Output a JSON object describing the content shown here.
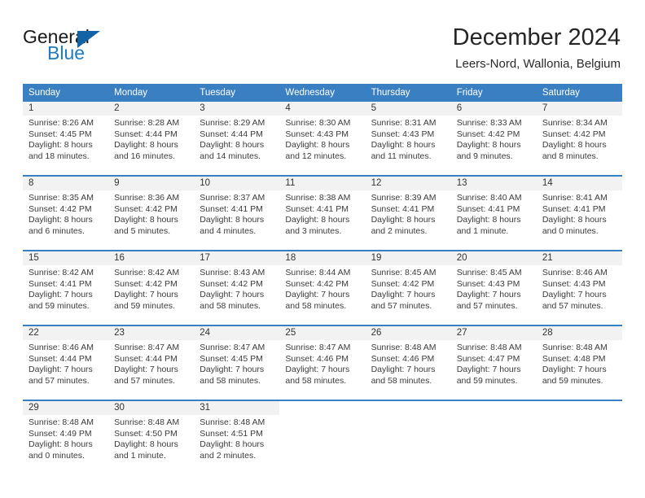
{
  "brand": {
    "word_one": "General",
    "word_two": "Blue",
    "accent_color": "#1464a5",
    "blue_text_color": "#1f7bc1"
  },
  "header": {
    "title": "December 2024",
    "subtitle": "Leers-Nord, Wallonia, Belgium"
  },
  "calendar": {
    "header_bg": "#3a7fc1",
    "daynum_bg": "#f2f2f2",
    "day_names": [
      "Sunday",
      "Monday",
      "Tuesday",
      "Wednesday",
      "Thursday",
      "Friday",
      "Saturday"
    ],
    "weeks": [
      [
        {
          "day": "1",
          "lines": [
            "Sunrise: 8:26 AM",
            "Sunset: 4:45 PM",
            "Daylight: 8 hours",
            "and 18 minutes."
          ]
        },
        {
          "day": "2",
          "lines": [
            "Sunrise: 8:28 AM",
            "Sunset: 4:44 PM",
            "Daylight: 8 hours",
            "and 16 minutes."
          ]
        },
        {
          "day": "3",
          "lines": [
            "Sunrise: 8:29 AM",
            "Sunset: 4:44 PM",
            "Daylight: 8 hours",
            "and 14 minutes."
          ]
        },
        {
          "day": "4",
          "lines": [
            "Sunrise: 8:30 AM",
            "Sunset: 4:43 PM",
            "Daylight: 8 hours",
            "and 12 minutes."
          ]
        },
        {
          "day": "5",
          "lines": [
            "Sunrise: 8:31 AM",
            "Sunset: 4:43 PM",
            "Daylight: 8 hours",
            "and 11 minutes."
          ]
        },
        {
          "day": "6",
          "lines": [
            "Sunrise: 8:33 AM",
            "Sunset: 4:42 PM",
            "Daylight: 8 hours",
            "and 9 minutes."
          ]
        },
        {
          "day": "7",
          "lines": [
            "Sunrise: 8:34 AM",
            "Sunset: 4:42 PM",
            "Daylight: 8 hours",
            "and 8 minutes."
          ]
        }
      ],
      [
        {
          "day": "8",
          "lines": [
            "Sunrise: 8:35 AM",
            "Sunset: 4:42 PM",
            "Daylight: 8 hours",
            "and 6 minutes."
          ]
        },
        {
          "day": "9",
          "lines": [
            "Sunrise: 8:36 AM",
            "Sunset: 4:42 PM",
            "Daylight: 8 hours",
            "and 5 minutes."
          ]
        },
        {
          "day": "10",
          "lines": [
            "Sunrise: 8:37 AM",
            "Sunset: 4:41 PM",
            "Daylight: 8 hours",
            "and 4 minutes."
          ]
        },
        {
          "day": "11",
          "lines": [
            "Sunrise: 8:38 AM",
            "Sunset: 4:41 PM",
            "Daylight: 8 hours",
            "and 3 minutes."
          ]
        },
        {
          "day": "12",
          "lines": [
            "Sunrise: 8:39 AM",
            "Sunset: 4:41 PM",
            "Daylight: 8 hours",
            "and 2 minutes."
          ]
        },
        {
          "day": "13",
          "lines": [
            "Sunrise: 8:40 AM",
            "Sunset: 4:41 PM",
            "Daylight: 8 hours",
            "and 1 minute."
          ]
        },
        {
          "day": "14",
          "lines": [
            "Sunrise: 8:41 AM",
            "Sunset: 4:41 PM",
            "Daylight: 8 hours",
            "and 0 minutes."
          ]
        }
      ],
      [
        {
          "day": "15",
          "lines": [
            "Sunrise: 8:42 AM",
            "Sunset: 4:41 PM",
            "Daylight: 7 hours",
            "and 59 minutes."
          ]
        },
        {
          "day": "16",
          "lines": [
            "Sunrise: 8:42 AM",
            "Sunset: 4:42 PM",
            "Daylight: 7 hours",
            "and 59 minutes."
          ]
        },
        {
          "day": "17",
          "lines": [
            "Sunrise: 8:43 AM",
            "Sunset: 4:42 PM",
            "Daylight: 7 hours",
            "and 58 minutes."
          ]
        },
        {
          "day": "18",
          "lines": [
            "Sunrise: 8:44 AM",
            "Sunset: 4:42 PM",
            "Daylight: 7 hours",
            "and 58 minutes."
          ]
        },
        {
          "day": "19",
          "lines": [
            "Sunrise: 8:45 AM",
            "Sunset: 4:42 PM",
            "Daylight: 7 hours",
            "and 57 minutes."
          ]
        },
        {
          "day": "20",
          "lines": [
            "Sunrise: 8:45 AM",
            "Sunset: 4:43 PM",
            "Daylight: 7 hours",
            "and 57 minutes."
          ]
        },
        {
          "day": "21",
          "lines": [
            "Sunrise: 8:46 AM",
            "Sunset: 4:43 PM",
            "Daylight: 7 hours",
            "and 57 minutes."
          ]
        }
      ],
      [
        {
          "day": "22",
          "lines": [
            "Sunrise: 8:46 AM",
            "Sunset: 4:44 PM",
            "Daylight: 7 hours",
            "and 57 minutes."
          ]
        },
        {
          "day": "23",
          "lines": [
            "Sunrise: 8:47 AM",
            "Sunset: 4:44 PM",
            "Daylight: 7 hours",
            "and 57 minutes."
          ]
        },
        {
          "day": "24",
          "lines": [
            "Sunrise: 8:47 AM",
            "Sunset: 4:45 PM",
            "Daylight: 7 hours",
            "and 58 minutes."
          ]
        },
        {
          "day": "25",
          "lines": [
            "Sunrise: 8:47 AM",
            "Sunset: 4:46 PM",
            "Daylight: 7 hours",
            "and 58 minutes."
          ]
        },
        {
          "day": "26",
          "lines": [
            "Sunrise: 8:48 AM",
            "Sunset: 4:46 PM",
            "Daylight: 7 hours",
            "and 58 minutes."
          ]
        },
        {
          "day": "27",
          "lines": [
            "Sunrise: 8:48 AM",
            "Sunset: 4:47 PM",
            "Daylight: 7 hours",
            "and 59 minutes."
          ]
        },
        {
          "day": "28",
          "lines": [
            "Sunrise: 8:48 AM",
            "Sunset: 4:48 PM",
            "Daylight: 7 hours",
            "and 59 minutes."
          ]
        }
      ],
      [
        {
          "day": "29",
          "lines": [
            "Sunrise: 8:48 AM",
            "Sunset: 4:49 PM",
            "Daylight: 8 hours",
            "and 0 minutes."
          ]
        },
        {
          "day": "30",
          "lines": [
            "Sunrise: 8:48 AM",
            "Sunset: 4:50 PM",
            "Daylight: 8 hours",
            "and 1 minute."
          ]
        },
        {
          "day": "31",
          "lines": [
            "Sunrise: 8:48 AM",
            "Sunset: 4:51 PM",
            "Daylight: 8 hours",
            "and 2 minutes."
          ]
        },
        {
          "day": "",
          "lines": []
        },
        {
          "day": "",
          "lines": []
        },
        {
          "day": "",
          "lines": []
        },
        {
          "day": "",
          "lines": []
        }
      ]
    ]
  }
}
